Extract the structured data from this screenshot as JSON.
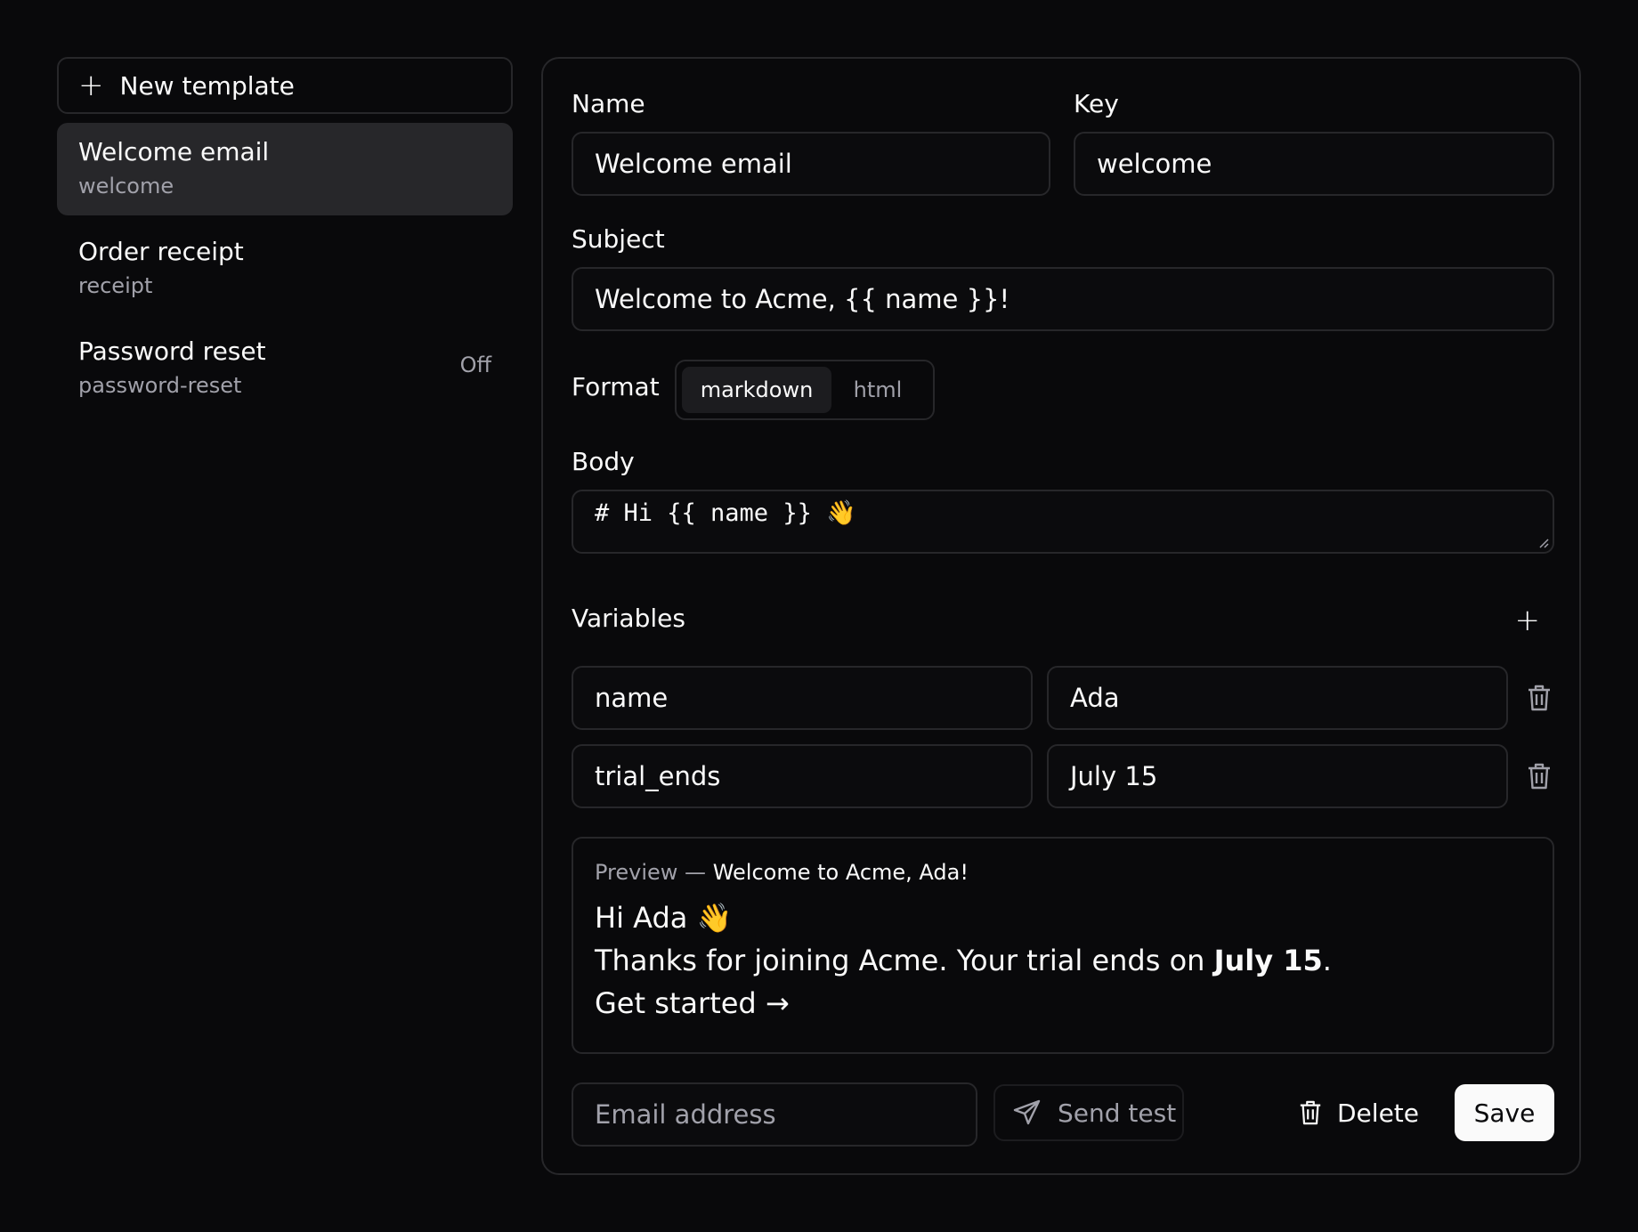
{
  "sidebar": {
    "new_template_label": "New template",
    "templates": [
      {
        "name": "Welcome email",
        "key": "welcome",
        "status": ""
      },
      {
        "name": "Order receipt",
        "key": "receipt",
        "status": ""
      },
      {
        "name": "Password reset",
        "key": "password-reset",
        "status": "Off"
      }
    ]
  },
  "editor": {
    "name_label": "Name",
    "name_value": "Welcome email",
    "key_label": "Key",
    "key_value": "welcome",
    "subject_label": "Subject",
    "subject_value": "Welcome to Acme, {{ name }}!",
    "format_label": "Format",
    "format_options": [
      "markdown",
      "html"
    ],
    "format_selected": "markdown",
    "body_label": "Body",
    "body_value": "# Hi {{ name }} 👋",
    "variables_label": "Variables",
    "variables": [
      {
        "name": "name",
        "value": "Ada"
      },
      {
        "name": "trial_ends",
        "value": "July 15"
      }
    ]
  },
  "preview": {
    "label": "Preview —",
    "subject": "Welcome to Acme, Ada!",
    "line1": "Hi Ada 👋",
    "line2_prefix": "Thanks for joining Acme. Your trial ends on ",
    "line2_bold": "July 15",
    "line2_suffix": ".",
    "line3": "Get started →"
  },
  "footer": {
    "email_placeholder": "Email address",
    "send_test_label": "Send test",
    "delete_label": "Delete",
    "save_label": "Save"
  },
  "icons": {
    "new": "plus-icon",
    "add_variable": "plus-icon",
    "remove_variable": "trash-icon",
    "send": "send-icon",
    "delete": "trash-icon"
  },
  "colors": {
    "background": "#09090b",
    "border": "#27272a",
    "active_item": "#27272a",
    "muted_text": "#a1a1aa",
    "primary_button": "#fafafa"
  }
}
